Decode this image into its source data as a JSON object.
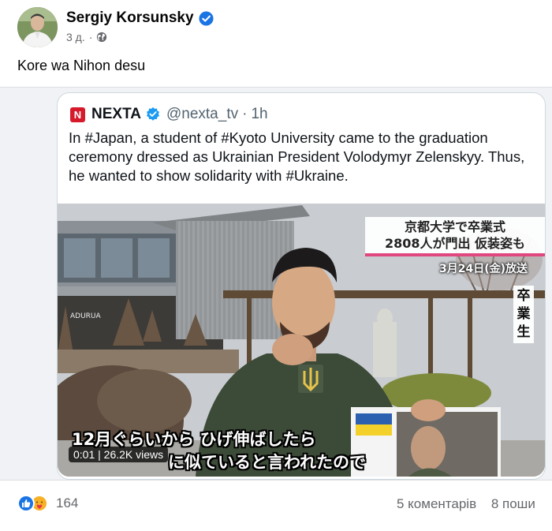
{
  "post": {
    "author": "Sergiy Korsunsky",
    "time": "3 д.",
    "separator": "·",
    "text": "Kore wa Nihon desu"
  },
  "tweet": {
    "name": "NEXTA",
    "logo_letter": "N",
    "handle": "@nexta_tv",
    "separator": "·",
    "time": "1h",
    "text": "In #Japan, a student of #Kyoto University came to the graduation ceremony dressed as Ukrainian President Volodymyr Zelenskyy. Thus, he wanted to show solidarity with #Ukraine."
  },
  "video": {
    "overlay_title_line1": "京都大学で卒業式",
    "overlay_title_line2": "2808人が門出 仮装姿も",
    "overlay_date": "3月24日(金)放送",
    "overlay_vertical": "卒業生",
    "subtitle_line1": "12月ぐらいから ひげ伸ばしたら",
    "subtitle_line2": "に似ていると言われたので",
    "time_views": "0:01 | 26.2K views",
    "building_sign": "ADURUA"
  },
  "footer": {
    "reaction_count": "164",
    "comments": "5 коментарів",
    "shares": "8 поши"
  },
  "colors": {
    "facebook_blue": "#1b74e4",
    "twitter_blue": "#1d9bf0",
    "nexta_red": "#d61a2b",
    "overlay_pink": "#e0477f"
  },
  "icons": {
    "verified": "verified-badge-icon",
    "globe": "globe-icon",
    "like": "like-reaction-icon",
    "care": "care-reaction-icon"
  }
}
